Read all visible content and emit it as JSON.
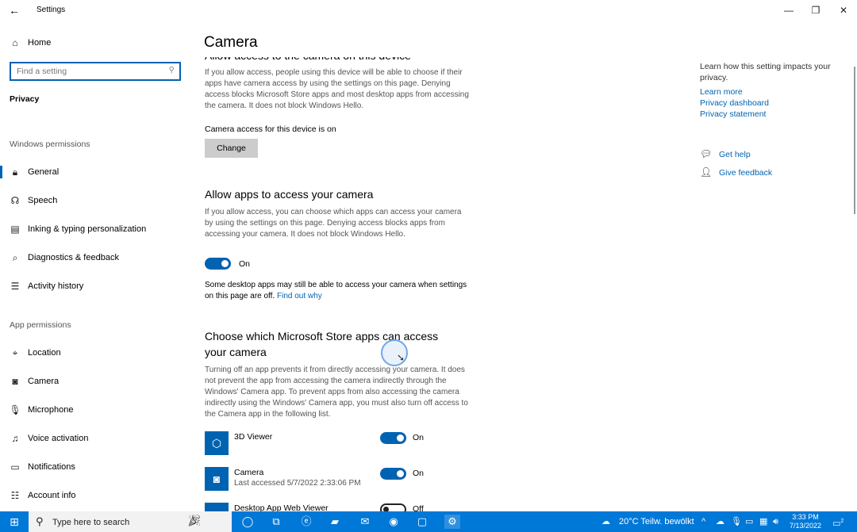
{
  "window": {
    "title": "Settings",
    "back_icon": "←",
    "minimize": "—",
    "restore": "❐",
    "close": "✕"
  },
  "sidebar": {
    "home": "Home",
    "search_placeholder": "Find a setting",
    "privacy": "Privacy",
    "windows_permissions_header": "Windows permissions",
    "windows_items": [
      {
        "label": "General",
        "icon": "lock-icon"
      },
      {
        "label": "Speech",
        "icon": "speech-icon"
      },
      {
        "label": "Inking & typing personalization",
        "icon": "inking-icon"
      },
      {
        "label": "Diagnostics & feedback",
        "icon": "diagnostics-icon"
      },
      {
        "label": "Activity history",
        "icon": "activity-icon"
      }
    ],
    "app_permissions_header": "App permissions",
    "app_items": [
      {
        "label": "Location",
        "icon": "location-icon"
      },
      {
        "label": "Camera",
        "icon": "camera-icon"
      },
      {
        "label": "Microphone",
        "icon": "microphone-icon"
      },
      {
        "label": "Voice activation",
        "icon": "voice-icon"
      },
      {
        "label": "Notifications",
        "icon": "notifications-icon"
      },
      {
        "label": "Account info",
        "icon": "account-icon"
      }
    ]
  },
  "main": {
    "title": "Camera",
    "section1_title": "Allow access to the camera on this device",
    "section1_text": "If you allow access, people using this device will be able to choose if their apps have camera access by using the settings on this page. Denying access blocks Microsoft Store apps and most desktop apps from accessing the camera. It does not block Windows Hello.",
    "device_status": "Camera access for this device is on",
    "change_button": "Change",
    "section2_title": "Allow apps to access your camera",
    "section2_text": "If you allow access, you can choose which apps can access your camera by using the settings on this page. Denying access blocks apps from accessing your camera. It does not block Windows Hello.",
    "apps_toggle_label": "On",
    "desktop_note": "Some desktop apps may still be able to access your camera when settings on this page are off.",
    "find_out_why": "Find out why",
    "section3_title_line1": "Choose which Microsoft Store apps can access",
    "section3_title_line2": "your camera",
    "section3_text": "Turning off an app prevents it from directly accessing your camera. It does not prevent the app from accessing the camera indirectly through the Windows' Camera app. To prevent apps from also accessing the camera indirectly using the Windows' Camera app, you must also turn off access to the Camera app in the following list.",
    "apps": [
      {
        "name": "3D Viewer",
        "sub": "",
        "state": "On",
        "on": true
      },
      {
        "name": "Camera",
        "sub": "Last accessed 5/7/2022 2:33:06 PM",
        "state": "On",
        "on": true
      },
      {
        "name": "Desktop App Web Viewer",
        "sub": "",
        "state": "Off",
        "on": false
      }
    ]
  },
  "right_panel": {
    "description": "Learn how this setting impacts your privacy.",
    "learn_more": "Learn more",
    "privacy_dashboard": "Privacy dashboard",
    "privacy_statement": "Privacy statement",
    "get_help": "Get help",
    "give_feedback": "Give feedback"
  },
  "taskbar": {
    "search_placeholder": "Type here to search",
    "weather": "20°C  Teilw. bewölkt",
    "time": "3:33 PM",
    "date": "7/13/2022",
    "notification_count": "2"
  }
}
